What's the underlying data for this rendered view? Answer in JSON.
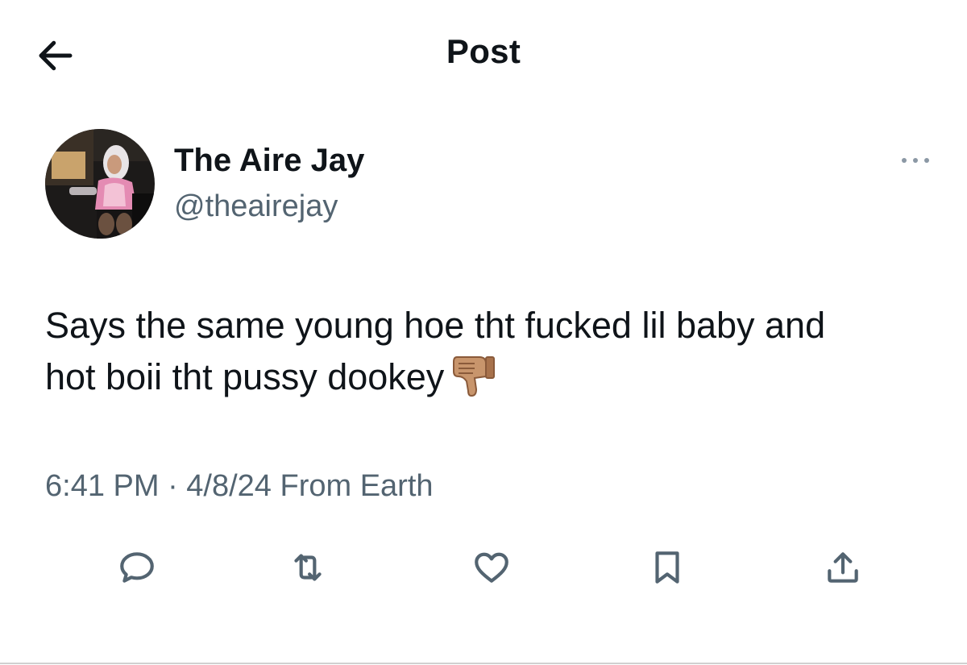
{
  "header": {
    "title": "Post",
    "back_icon": "arrow-left-icon"
  },
  "author": {
    "display_name": "The Aire Jay",
    "handle": "@theairejay",
    "avatar": "profile-photo",
    "more_icon": "more-horizontal-icon"
  },
  "tweet": {
    "text_line1": "Says the same young hoe tht fucked lil baby and",
    "text_line2": "hot boii tht pussy dookey",
    "emoji": "thumbs-down-emoji",
    "timestamp": "6:41 PM · 4/8/24 From Earth"
  },
  "actions": [
    {
      "name": "reply",
      "icon": "reply-icon"
    },
    {
      "name": "repost",
      "icon": "repost-icon"
    },
    {
      "name": "like",
      "icon": "heart-icon"
    },
    {
      "name": "bookmark",
      "icon": "bookmark-icon"
    },
    {
      "name": "share",
      "icon": "share-icon"
    }
  ],
  "colors": {
    "primary_text": "#0f1419",
    "secondary_text": "#536471",
    "icon": "#536471",
    "background": "#ffffff"
  }
}
